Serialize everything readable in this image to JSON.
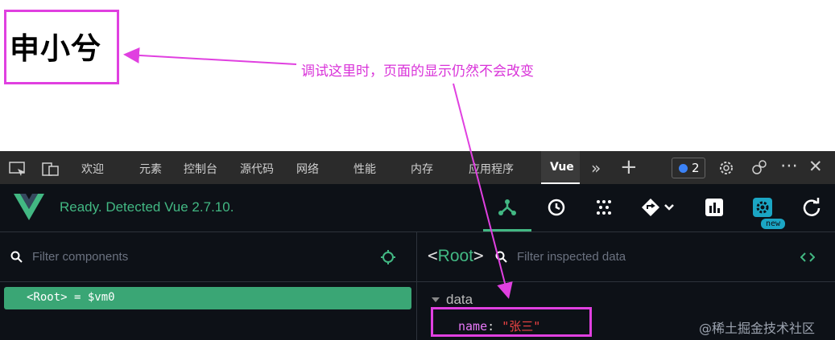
{
  "page": {
    "title": "申小兮"
  },
  "annotation": {
    "text": "调试这里时，页面的显示仍然不会改变"
  },
  "devtools": {
    "tabs": [
      "欢迎",
      "元素",
      "控制台",
      "源代码",
      "网络",
      "性能",
      "内存",
      "应用程序",
      "Vue"
    ],
    "active_tab": "Vue",
    "issues_count": "2"
  },
  "vue": {
    "status": "Ready. Detected Vue 2.7.10.",
    "new_badge": "new"
  },
  "components": {
    "filter_placeholder": "Filter components",
    "root_item": "<Root> = $vm0"
  },
  "inspector": {
    "root_open": "<",
    "root_name": "Root",
    "root_close": ">",
    "filter_placeholder": "Filter inspected data",
    "section": "data",
    "prop_key": "name",
    "prop_colon": ": ",
    "prop_value": "\"张三\""
  },
  "watermark": "@稀土掘金技术社区",
  "colors": {
    "vue_green": "#42b883",
    "highlight": "#e040e0",
    "tab_bar": "#2b2b2b",
    "panel": "#0d1117"
  }
}
